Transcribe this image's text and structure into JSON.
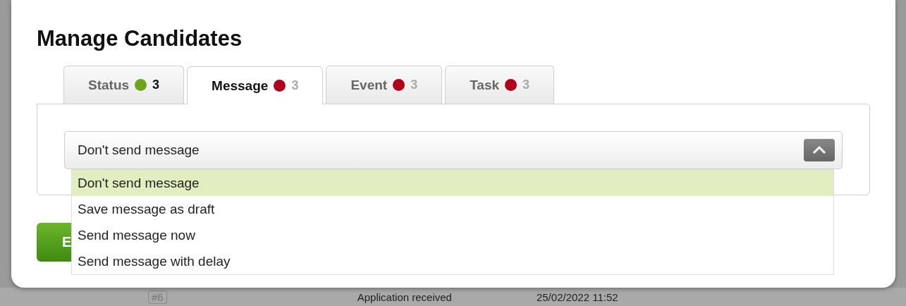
{
  "dialog": {
    "title": "Manage Candidates"
  },
  "tabs": [
    {
      "label": "Status",
      "color": "#6aa51c",
      "count": "3",
      "done": true,
      "selected": false
    },
    {
      "label": "Message",
      "color": "#b0001a",
      "count": "3",
      "done": false,
      "selected": true
    },
    {
      "label": "Event",
      "color": "#b0001a",
      "count": "3",
      "done": false,
      "selected": false
    },
    {
      "label": "Task",
      "color": "#b0001a",
      "count": "3",
      "done": false,
      "selected": false
    }
  ],
  "message_select": {
    "value": "Don't send message",
    "expanded": true,
    "options": [
      {
        "label": "Don't send message",
        "selected": true
      },
      {
        "label": "Save message as draft",
        "selected": false
      },
      {
        "label": "Send message now",
        "selected": false
      },
      {
        "label": "Send message with delay",
        "selected": false
      }
    ]
  },
  "primary_button": {
    "label": "E"
  },
  "background_row": {
    "number": "#6",
    "status": "Application received",
    "date": "25/02/2022 11:52"
  }
}
